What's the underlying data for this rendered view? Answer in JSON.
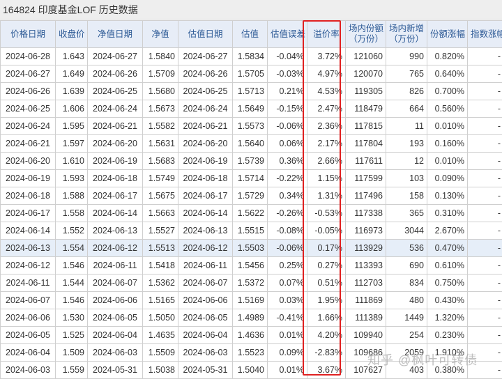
{
  "page_title": "164824 印度基金LOF 历史数据",
  "columns": [
    {
      "label": "价格日期",
      "sub": ""
    },
    {
      "label": "收盘价",
      "sub": ""
    },
    {
      "label": "净值日期",
      "sub": ""
    },
    {
      "label": "净值",
      "sub": ""
    },
    {
      "label": "估值日期",
      "sub": ""
    },
    {
      "label": "估值",
      "sub": ""
    },
    {
      "label": "估值误差",
      "sub": ""
    },
    {
      "label": "溢价率",
      "sub": ""
    },
    {
      "label": "场内份额",
      "sub": "（万份）"
    },
    {
      "label": "场内新增",
      "sub": "（万份）"
    },
    {
      "label": "份额涨幅",
      "sub": ""
    },
    {
      "label": "指数涨幅",
      "sub": ""
    }
  ],
  "rows": [
    [
      "2024-06-28",
      "1.643",
      "2024-06-27",
      "1.5840",
      "2024-06-27",
      "1.5834",
      "-0.04%",
      "3.72%",
      "121060",
      "990",
      "0.820%",
      "-"
    ],
    [
      "2024-06-27",
      "1.649",
      "2024-06-26",
      "1.5709",
      "2024-06-26",
      "1.5705",
      "-0.03%",
      "4.97%",
      "120070",
      "765",
      "0.640%",
      "-"
    ],
    [
      "2024-06-26",
      "1.639",
      "2024-06-25",
      "1.5680",
      "2024-06-25",
      "1.5713",
      "0.21%",
      "4.53%",
      "119305",
      "826",
      "0.700%",
      "-"
    ],
    [
      "2024-06-25",
      "1.606",
      "2024-06-24",
      "1.5673",
      "2024-06-24",
      "1.5649",
      "-0.15%",
      "2.47%",
      "118479",
      "664",
      "0.560%",
      "-"
    ],
    [
      "2024-06-24",
      "1.595",
      "2024-06-21",
      "1.5582",
      "2024-06-21",
      "1.5573",
      "-0.06%",
      "2.36%",
      "117815",
      "11",
      "0.010%",
      "-"
    ],
    [
      "2024-06-21",
      "1.597",
      "2024-06-20",
      "1.5631",
      "2024-06-20",
      "1.5640",
      "0.06%",
      "2.17%",
      "117804",
      "193",
      "0.160%",
      "-"
    ],
    [
      "2024-06-20",
      "1.610",
      "2024-06-19",
      "1.5683",
      "2024-06-19",
      "1.5739",
      "0.36%",
      "2.66%",
      "117611",
      "12",
      "0.010%",
      "-"
    ],
    [
      "2024-06-19",
      "1.593",
      "2024-06-18",
      "1.5749",
      "2024-06-18",
      "1.5714",
      "-0.22%",
      "1.15%",
      "117599",
      "103",
      "0.090%",
      "-"
    ],
    [
      "2024-06-18",
      "1.588",
      "2024-06-17",
      "1.5675",
      "2024-06-17",
      "1.5729",
      "0.34%",
      "1.31%",
      "117496",
      "158",
      "0.130%",
      "-"
    ],
    [
      "2024-06-17",
      "1.558",
      "2024-06-14",
      "1.5663",
      "2024-06-14",
      "1.5622",
      "-0.26%",
      "-0.53%",
      "117338",
      "365",
      "0.310%",
      "-"
    ],
    [
      "2024-06-14",
      "1.552",
      "2024-06-13",
      "1.5527",
      "2024-06-13",
      "1.5515",
      "-0.08%",
      "-0.05%",
      "116973",
      "3044",
      "2.670%",
      "-"
    ],
    [
      "2024-06-13",
      "1.554",
      "2024-06-12",
      "1.5513",
      "2024-06-12",
      "1.5503",
      "-0.06%",
      "0.17%",
      "113929",
      "536",
      "0.470%",
      "-"
    ],
    [
      "2024-06-12",
      "1.546",
      "2024-06-11",
      "1.5418",
      "2024-06-11",
      "1.5456",
      "0.25%",
      "0.27%",
      "113393",
      "690",
      "0.610%",
      "-"
    ],
    [
      "2024-06-11",
      "1.544",
      "2024-06-07",
      "1.5362",
      "2024-06-07",
      "1.5372",
      "0.07%",
      "0.51%",
      "112703",
      "834",
      "0.750%",
      "-"
    ],
    [
      "2024-06-07",
      "1.546",
      "2024-06-06",
      "1.5165",
      "2024-06-06",
      "1.5169",
      "0.03%",
      "1.95%",
      "111869",
      "480",
      "0.430%",
      "-"
    ],
    [
      "2024-06-06",
      "1.530",
      "2024-06-05",
      "1.5050",
      "2024-06-05",
      "1.4989",
      "-0.41%",
      "1.66%",
      "111389",
      "1449",
      "1.320%",
      "-"
    ],
    [
      "2024-06-05",
      "1.525",
      "2024-06-04",
      "1.4635",
      "2024-06-04",
      "1.4636",
      "0.01%",
      "4.20%",
      "109940",
      "254",
      "0.230%",
      "-"
    ],
    [
      "2024-06-04",
      "1.509",
      "2024-06-03",
      "1.5509",
      "2024-06-03",
      "1.5523",
      "0.09%",
      "-2.83%",
      "109686",
      "2059",
      "1.910%",
      "-"
    ],
    [
      "2024-06-03",
      "1.559",
      "2024-05-31",
      "1.5038",
      "2024-05-31",
      "1.5040",
      "0.01%",
      "3.67%",
      "107627",
      "403",
      "0.380%",
      "-"
    ]
  ],
  "highlighted_row": 11,
  "watermark": "知乎 @枫叶可转债",
  "colors": {
    "header_bg": "#e7edf7",
    "header_text": "#2d5a96",
    "highlight_row_bg": "#e6eef8",
    "annotation_box": "#e02020"
  }
}
